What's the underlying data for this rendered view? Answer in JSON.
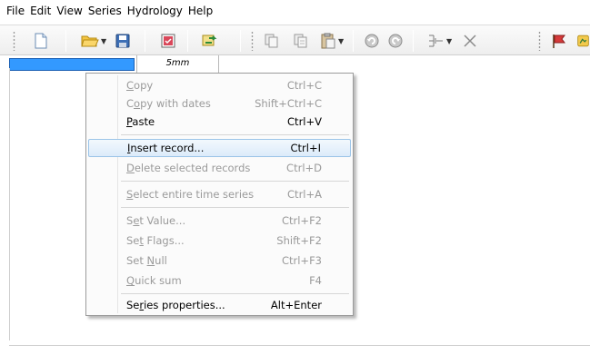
{
  "menubar": {
    "items": [
      {
        "label": "File"
      },
      {
        "label": "Edit"
      },
      {
        "label": "View"
      },
      {
        "label": "Series"
      },
      {
        "label": "Hydrology"
      },
      {
        "label": "Help"
      }
    ]
  },
  "toolbar": {
    "icons": [
      "new-document-icon",
      "open-folder-icon",
      "save-icon",
      "properties-icon",
      "refresh-arrow-icon",
      "copy-icon",
      "copy-with-dates-icon",
      "paste-icon",
      "undo-icon",
      "redo-icon",
      "insert-record-icon",
      "delete-icon",
      "flag-icon"
    ]
  },
  "grid": {
    "column_header": "5mm"
  },
  "context_menu": {
    "items": [
      {
        "pre": "",
        "u": "C",
        "post": "opy",
        "shortcut": "Ctrl+C",
        "enabled": false
      },
      {
        "pre": "C",
        "u": "o",
        "post": "py with dates",
        "shortcut": "Shift+Ctrl+C",
        "enabled": false
      },
      {
        "pre": "",
        "u": "P",
        "post": "aste",
        "shortcut": "Ctrl+V",
        "enabled": true
      },
      {
        "pre": "",
        "u": "I",
        "post": "nsert record...",
        "shortcut": "Ctrl+I",
        "enabled": true,
        "highlighted": true
      },
      {
        "pre": "",
        "u": "D",
        "post": "elete selected records",
        "shortcut": "Ctrl+D",
        "enabled": false
      },
      {
        "pre": "",
        "u": "S",
        "post": "elect entire time series",
        "shortcut": "Ctrl+A",
        "enabled": false
      },
      {
        "pre": "S",
        "u": "e",
        "post": "t Value...",
        "shortcut": "Ctrl+F2",
        "enabled": false
      },
      {
        "pre": "Se",
        "u": "t",
        "post": " Flags...",
        "shortcut": "Shift+F2",
        "enabled": false
      },
      {
        "pre": "Set ",
        "u": "N",
        "post": "ull",
        "shortcut": "Ctrl+F3",
        "enabled": false
      },
      {
        "pre": "",
        "u": "Q",
        "post": "uick sum",
        "shortcut": "F4",
        "enabled": false
      },
      {
        "pre": "Se",
        "u": "r",
        "post": "ies properties...",
        "shortcut": "Alt+Enter",
        "enabled": true
      }
    ]
  },
  "colors": {
    "selection": "#3399ff",
    "menu_highlight_border": "#9bc4e8",
    "disabled_text": "#9a9a9a"
  }
}
